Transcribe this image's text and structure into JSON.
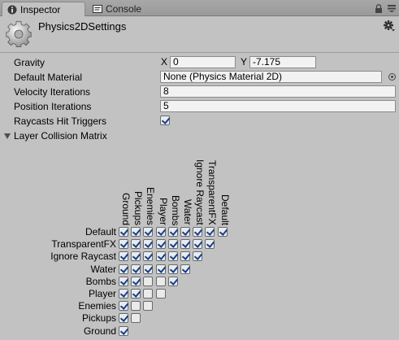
{
  "tabs": [
    {
      "label": "Inspector",
      "icon": "info-icon",
      "active": true
    },
    {
      "label": "Console",
      "icon": "console-icon",
      "active": false
    }
  ],
  "header": {
    "title": "Physics2DSettings",
    "icon": "gear-asset-icon"
  },
  "properties": {
    "gravity": {
      "label": "Gravity",
      "x_axis": "X",
      "x": "0",
      "y_axis": "Y",
      "y": "-7.175"
    },
    "default_material": {
      "label": "Default Material",
      "value": "None (Physics Material 2D)"
    },
    "velocity_iterations": {
      "label": "Velocity Iterations",
      "value": "8"
    },
    "position_iterations": {
      "label": "Position Iterations",
      "value": "5"
    },
    "raycasts_hit_triggers": {
      "label": "Raycasts Hit Triggers",
      "checked": true
    }
  },
  "matrix": {
    "label": "Layer Collision Matrix",
    "columns": [
      "Ground",
      "Pickups",
      "Enemies",
      "Player",
      "Bombs",
      "Water",
      "Ignore Raycast",
      "TransparentFX",
      "Default"
    ],
    "rows": [
      {
        "label": "Default",
        "cells": [
          true,
          true,
          true,
          true,
          true,
          true,
          true,
          true,
          true
        ]
      },
      {
        "label": "TransparentFX",
        "cells": [
          true,
          true,
          true,
          true,
          true,
          true,
          true,
          true
        ]
      },
      {
        "label": "Ignore Raycast",
        "cells": [
          true,
          true,
          true,
          true,
          true,
          true,
          true
        ]
      },
      {
        "label": "Water",
        "cells": [
          true,
          true,
          true,
          true,
          true,
          true
        ]
      },
      {
        "label": "Bombs",
        "cells": [
          true,
          true,
          false,
          false,
          true
        ]
      },
      {
        "label": "Player",
        "cells": [
          true,
          true,
          false,
          false
        ]
      },
      {
        "label": "Enemies",
        "cells": [
          true,
          false,
          false
        ]
      },
      {
        "label": "Pickups",
        "cells": [
          true,
          false
        ]
      },
      {
        "label": "Ground",
        "cells": [
          true
        ]
      }
    ]
  }
}
